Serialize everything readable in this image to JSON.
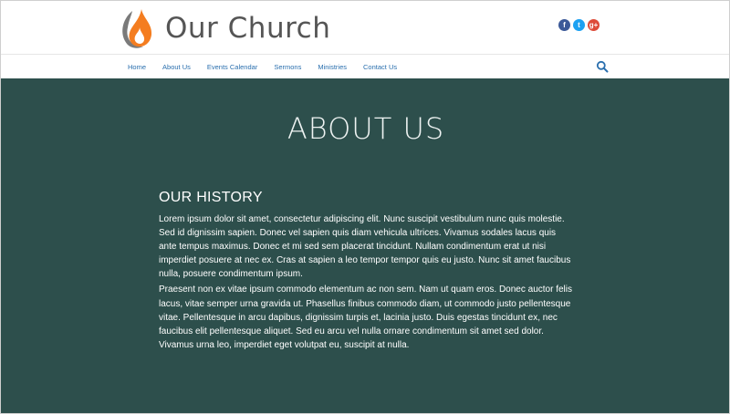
{
  "site": {
    "brand": "Our Church",
    "logo_colors": {
      "flame_outer": "#f47d20",
      "flame_inner": "#ffffff",
      "swoosh": "#7a7a7a"
    }
  },
  "social": [
    {
      "name": "facebook",
      "glyph": "f",
      "color": "#3b5998"
    },
    {
      "name": "twitter",
      "glyph": "t",
      "color": "#1da1f2"
    },
    {
      "name": "google-plus",
      "glyph": "g+",
      "color": "#dd4b39"
    }
  ],
  "nav": {
    "items": [
      "Home",
      "About Us",
      "Events Calendar",
      "Sermons",
      "Ministries",
      "Contact Us"
    ],
    "search_icon": "search-icon",
    "link_color": "#2a6fae"
  },
  "page": {
    "title": "ABOUT US",
    "background": "#2d4f4c"
  },
  "history": {
    "heading": "OUR HISTORY",
    "paragraphs": [
      "Lorem ipsum dolor sit amet, consectetur adipiscing elit. Nunc suscipit vestibulum nunc quis molestie. Sed id dignissim sapien. Donec vel sapien quis diam vehicula ultrices. Vivamus sodales lacus quis ante tempus maximus. Donec et mi sed sem placerat tincidunt. Nullam condimentum erat ut nisi imperdiet posuere at nec ex. Cras at sapien a leo tempor tempor quis eu justo. Nunc sit amet faucibus nulla, posuere condimentum ipsum.",
      "Praesent non ex vitae ipsum commodo elementum ac non sem. Nam ut quam eros. Donec auctor felis lacus, vitae semper urna gravida ut. Phasellus finibus commodo diam, ut commodo justo pellentesque vitae. Pellentesque in arcu dapibus, dignissim turpis et, lacinia justo. Duis egestas tincidunt ex, nec faucibus elit pellentesque aliquet. Sed eu arcu vel nulla ornare condimentum sit amet sed dolor. Vivamus urna leo, imperdiet eget volutpat eu, suscipit at nulla."
    ]
  }
}
